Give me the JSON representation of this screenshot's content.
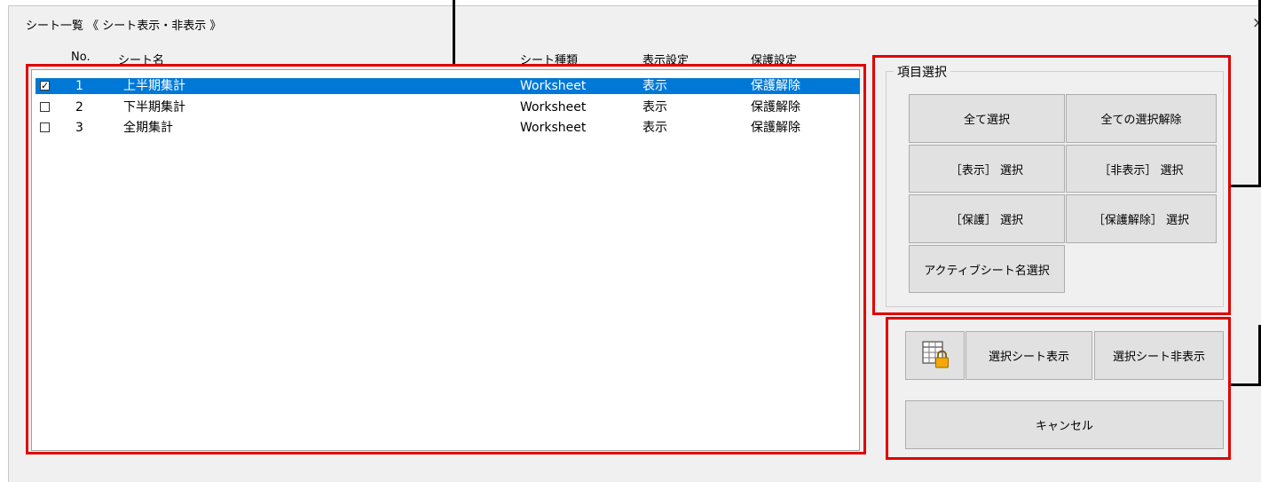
{
  "window": {
    "title": "シート一覧 《 シート表示・非表示 》",
    "close_glyph": "×"
  },
  "columns": {
    "no": "No.",
    "name": "シート名",
    "type": "シート種類",
    "display": "表示設定",
    "protect": "保護設定"
  },
  "rows": [
    {
      "checked": true,
      "check_glyph": "✓",
      "no": "1",
      "name": "上半期集計",
      "type": "Worksheet",
      "display": "表示",
      "protect": "保護解除"
    },
    {
      "checked": false,
      "check_glyph": "",
      "no": "2",
      "name": "下半期集計",
      "type": "Worksheet",
      "display": "表示",
      "protect": "保護解除"
    },
    {
      "checked": false,
      "check_glyph": "",
      "no": "3",
      "name": "全期集計",
      "type": "Worksheet",
      "display": "表示",
      "protect": "保護解除"
    }
  ],
  "selection_group": {
    "label": "項目選択",
    "select_all": "全て選択",
    "deselect_all": "全ての選択解除",
    "select_shown": "［表示］ 選択",
    "select_hidden": "［非表示］ 選択",
    "select_protected": "［保護］ 選択",
    "select_unprotected": "［保護解除］ 選択",
    "select_active_sheet": "アクティブシート名選択"
  },
  "actions": {
    "show_selected": "選択シート表示",
    "hide_selected": "選択シート非表示",
    "cancel": "キャンセル"
  },
  "colors": {
    "highlight": "#0078d7",
    "annotation_frame": "#e00000",
    "dialog_bg": "#f0f0f0"
  }
}
